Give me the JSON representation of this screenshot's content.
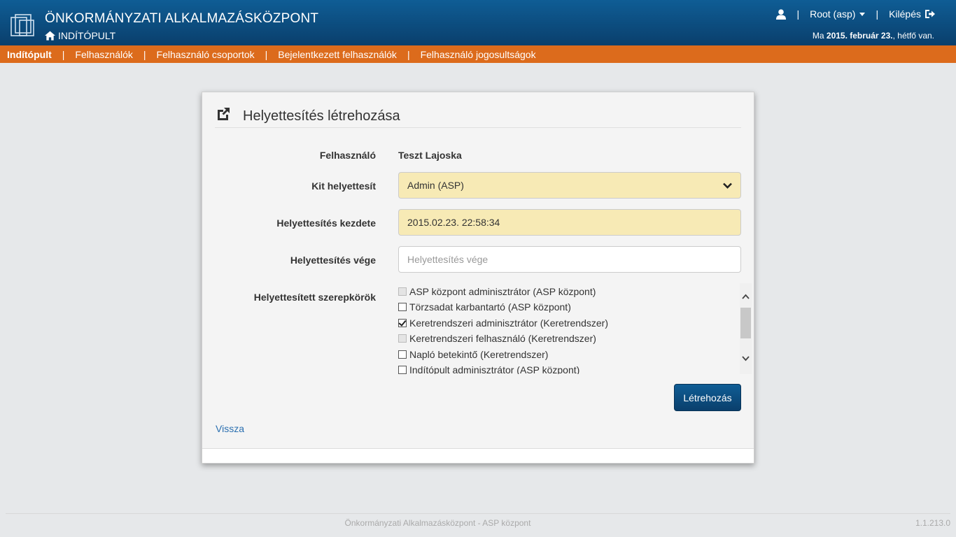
{
  "header": {
    "app_title": "ÖNKORMÁNYZATI ALKALMAZÁSKÖZPONT",
    "home_label": "INDÍTÓPULT",
    "user_label": "Root (asp)",
    "logout_label": "Kilépés",
    "date_prefix": "Ma",
    "date_value": "2015. február 23.",
    "date_suffix": ", hétfő van.",
    "separator": "|"
  },
  "nav": {
    "items": [
      {
        "label": "Indítópult",
        "active": true
      },
      {
        "label": "Felhasználók"
      },
      {
        "label": "Felhasználó csoportok"
      },
      {
        "label": "Bejelentkezett felhasználók"
      },
      {
        "label": "Felhasználó jogosultságok"
      }
    ],
    "separator": "|"
  },
  "form": {
    "title": "Helyettesítés létrehozása",
    "user_label": "Felhasználó",
    "user_value": "Teszt Lajoska",
    "substitute_label": "Kit helyettesít",
    "substitute_value": "Admin (ASP)",
    "start_label": "Helyettesítés kezdete",
    "start_value": "2015.02.23. 22:58:34",
    "end_label": "Helyettesítés vége",
    "end_placeholder": "Helyettesítés vége",
    "roles_label": "Helyettesített szerepkörök",
    "roles": [
      {
        "label": "ASP központ adminisztrátor (ASP központ)",
        "checked": false,
        "disabled": true
      },
      {
        "label": "Törzsadat karbantartó (ASP központ)",
        "checked": false,
        "disabled": false
      },
      {
        "label": "Keretrendszeri adminisztrátor (Keretrendszer)",
        "checked": true,
        "disabled": false
      },
      {
        "label": "Keretrendszeri felhasználó (Keretrendszer)",
        "checked": false,
        "disabled": true
      },
      {
        "label": "Napló betekintő (Keretrendszer)",
        "checked": false,
        "disabled": false
      },
      {
        "label": "Indítópult adminisztrátor (ASP központ)",
        "checked": false,
        "disabled": false
      }
    ],
    "create_button": "Létrehozás",
    "back_link": "Vissza"
  },
  "footer": {
    "center_text": "Önkormányzati Alkalmazásközpont - ASP központ",
    "version": "1.1.213.0"
  },
  "colors": {
    "header_blue": "#0a3f6c",
    "nav_orange": "#dc6b1c",
    "filled_field": "#f7eab5",
    "link_blue": "#2a6fb0"
  }
}
